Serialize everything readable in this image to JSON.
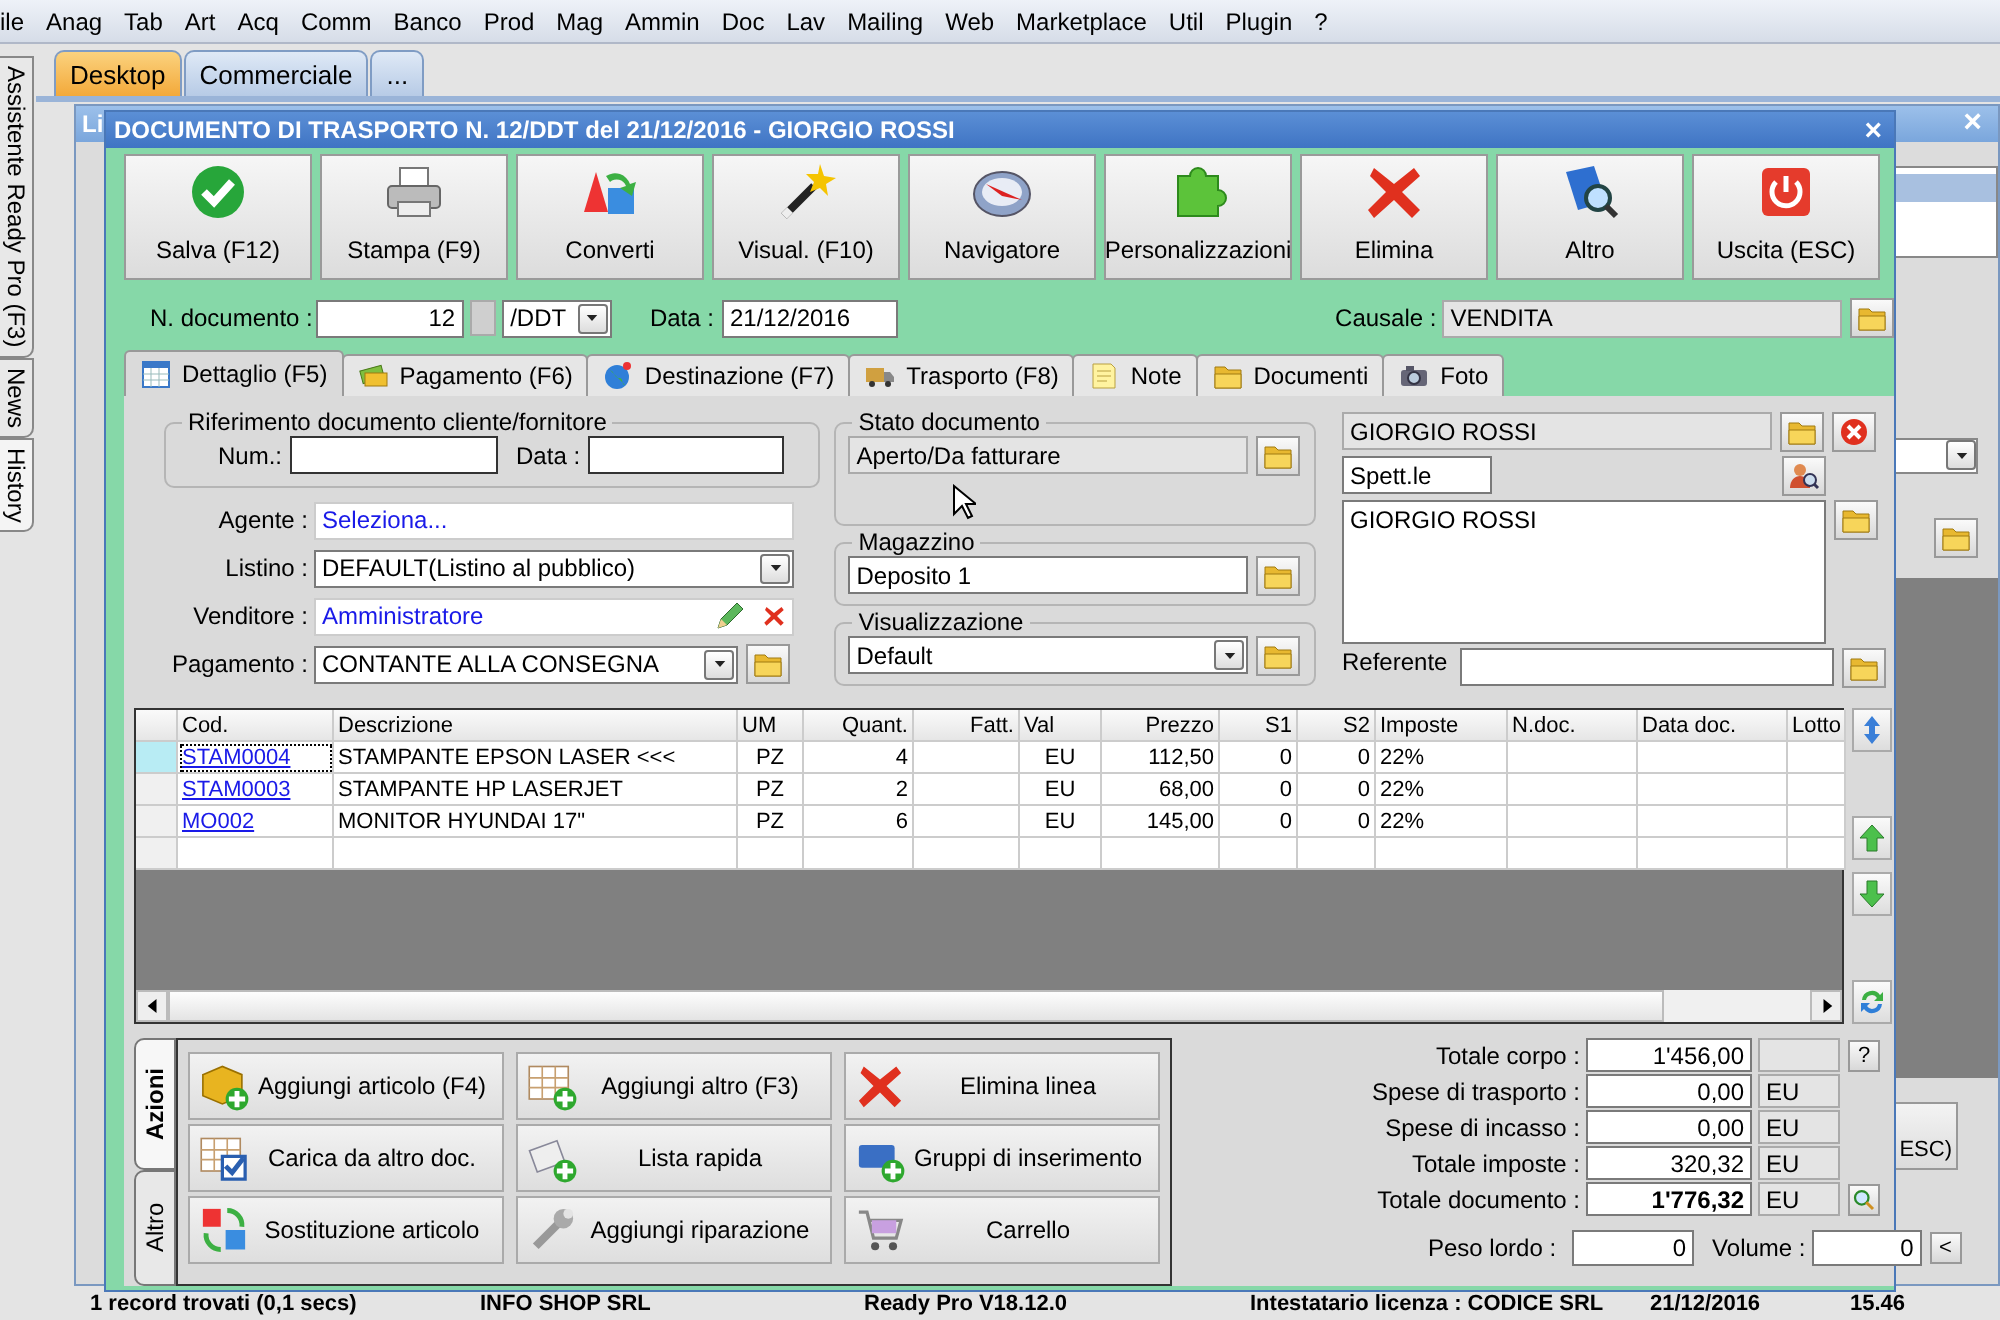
{
  "menu": [
    "ile",
    "Anag",
    "Tab",
    "Art",
    "Acq",
    "Comm",
    "Banco",
    "Prod",
    "Mag",
    "Ammin",
    "Doc",
    "Lav",
    "Mailing",
    "Web",
    "Marketplace",
    "Util",
    "Plugin",
    "?"
  ],
  "side_tabs": [
    {
      "label": "Assistente Ready Pro (F3)",
      "selected": false
    },
    {
      "label": "News",
      "selected": false
    },
    {
      "label": "History",
      "selected": true
    }
  ],
  "desktop_tabs": [
    {
      "label": "Desktop",
      "selected": true
    },
    {
      "label": "Commerciale",
      "selected": false
    },
    {
      "label": "...",
      "selected": false
    }
  ],
  "background_window": {
    "title": "Li",
    "close": "×",
    "exit_label": "ESC)"
  },
  "dialog": {
    "title": "DOCUMENTO DI TRASPORTO N. 12/DDT del 21/12/2016 - GIORGIO ROSSI",
    "close": "×"
  },
  "toolbar": [
    {
      "label": "Salva (F12)",
      "kind": "check"
    },
    {
      "label": "Stampa (F9)",
      "kind": "printer"
    },
    {
      "label": "Converti",
      "kind": "convert"
    },
    {
      "label": "Visual. (F10)",
      "kind": "wand"
    },
    {
      "label": "Navigatore",
      "kind": "compass"
    },
    {
      "label": "Personalizzazioni",
      "kind": "puzzle"
    },
    {
      "label": "Elimina",
      "kind": "cross"
    },
    {
      "label": "Altro",
      "kind": "book"
    },
    {
      "label": "Uscita (ESC)",
      "kind": "power"
    }
  ],
  "header": {
    "number_label": "N. documento :",
    "number": "12",
    "series": "/DDT",
    "date_label": "Data :",
    "date": "21/12/2016",
    "causale_label": "Causale :",
    "causale": "VENDITA"
  },
  "tabs": [
    {
      "label": "Dettaglio (F5)",
      "kind": "calendar",
      "selected": true
    },
    {
      "label": "Pagamento (F6)",
      "kind": "money",
      "selected": false
    },
    {
      "label": "Destinazione (F7)",
      "kind": "globe",
      "selected": false
    },
    {
      "label": "Trasporto (F8)",
      "kind": "truck",
      "selected": false
    },
    {
      "label": "Note",
      "kind": "note",
      "selected": false
    },
    {
      "label": "Documenti",
      "kind": "folder",
      "selected": false
    },
    {
      "label": "Foto",
      "kind": "camera",
      "selected": false
    }
  ],
  "reference": {
    "legend": "Riferimento documento cliente/fornitore",
    "num_label": "Num.:",
    "date_label": "Data :"
  },
  "fields": [
    {
      "label": "Agente :",
      "value": "Seleziona...",
      "kind": "link"
    },
    {
      "label": "Listino :",
      "value": "DEFAULT(Listino al pubblico)",
      "kind": "select"
    },
    {
      "label": "Venditore :",
      "value": "Amministratore",
      "kind": "picker"
    },
    {
      "label": "Pagamento :",
      "value": "CONTANTE ALLA CONSEGNA",
      "kind": "select_folder"
    }
  ],
  "status": {
    "legend": "Stato documento",
    "value": "Aperto/Da fatturare"
  },
  "warehouse": {
    "legend": "Magazzino",
    "value": "Deposito 1"
  },
  "view": {
    "legend": "Visualizzazione",
    "value": "Default"
  },
  "customer": {
    "name": "GIORGIO ROSSI",
    "title": "Spett.le",
    "address": "GIORGIO ROSSI",
    "contact_label": "Referente"
  },
  "grid": {
    "columns": [
      "Cod.",
      "Descrizione",
      "UM",
      "Quant.",
      "Fatt.",
      "Val",
      "Prezzo",
      "S1",
      "S2",
      "Imposte",
      "N.doc.",
      "Data doc.",
      "Lotto"
    ],
    "rows": [
      {
        "selected": true,
        "cod": "STAM0004",
        "desc": "STAMPANTE EPSON LASER <<<",
        "um": "PZ",
        "qty": "4",
        "val": "EU",
        "price": "112,50",
        "s1": "0",
        "s2": "0",
        "tax": "22%"
      },
      {
        "selected": false,
        "cod": "STAM0003",
        "desc": "STAMPANTE HP LASERJET",
        "um": "PZ",
        "qty": "2",
        "val": "EU",
        "price": "68,00",
        "s1": "0",
        "s2": "0",
        "tax": "22%"
      },
      {
        "selected": false,
        "cod": "MO002",
        "desc": "MONITOR HYUNDAI 17\"",
        "um": "PZ",
        "qty": "6",
        "val": "EU",
        "price": "145,00",
        "s1": "0",
        "s2": "0",
        "tax": "22%"
      }
    ]
  },
  "action_tabs": [
    {
      "label": "Azioni",
      "selected": true
    },
    {
      "label": "Altro",
      "selected": false
    }
  ],
  "actions": [
    {
      "label": "Aggiungi articolo (F4)",
      "kind": "box_add"
    },
    {
      "label": "Aggiungi altro (F3)",
      "kind": "grid_add"
    },
    {
      "label": "Elimina linea",
      "kind": "cross"
    },
    {
      "label": "Carica da altro doc.",
      "kind": "grid_check"
    },
    {
      "label": "Lista rapida",
      "kind": "list_add"
    },
    {
      "label": "Gruppi di inserimento",
      "kind": "group_add"
    },
    {
      "label": "Sostituzione articolo",
      "kind": "swap"
    },
    {
      "label": "Aggiungi riparazione",
      "kind": "wrench"
    },
    {
      "label": "Carrello",
      "kind": "cart"
    }
  ],
  "totals": [
    {
      "label": "Totale corpo :",
      "value": "1'456,00",
      "kind": "help",
      "button": "?"
    },
    {
      "label": "Spese di trasporto :",
      "value": "0,00",
      "currency": "EU",
      "kind": "plain"
    },
    {
      "label": "Spese di incasso :",
      "value": "0,00",
      "currency": "EU",
      "kind": "plain"
    },
    {
      "label": "Totale imposte :",
      "value": "320,32",
      "currency": "EU",
      "kind": "plain"
    },
    {
      "label": "Totale documento :",
      "value": "1'776,32",
      "currency": "EU",
      "kind": "zoom",
      "bold": true
    }
  ],
  "weights": {
    "weight_label": "Peso lordo :",
    "weight": "0",
    "volume_label": "Volume :",
    "volume": "0",
    "more": "<"
  },
  "status_bar": [
    "1 record trovati (0,1 secs)",
    "INFO SHOP SRL",
    "Ready Pro V18.12.0",
    "Intestatario licenza : CODICE SRL",
    "21/12/2016",
    "15.46"
  ]
}
